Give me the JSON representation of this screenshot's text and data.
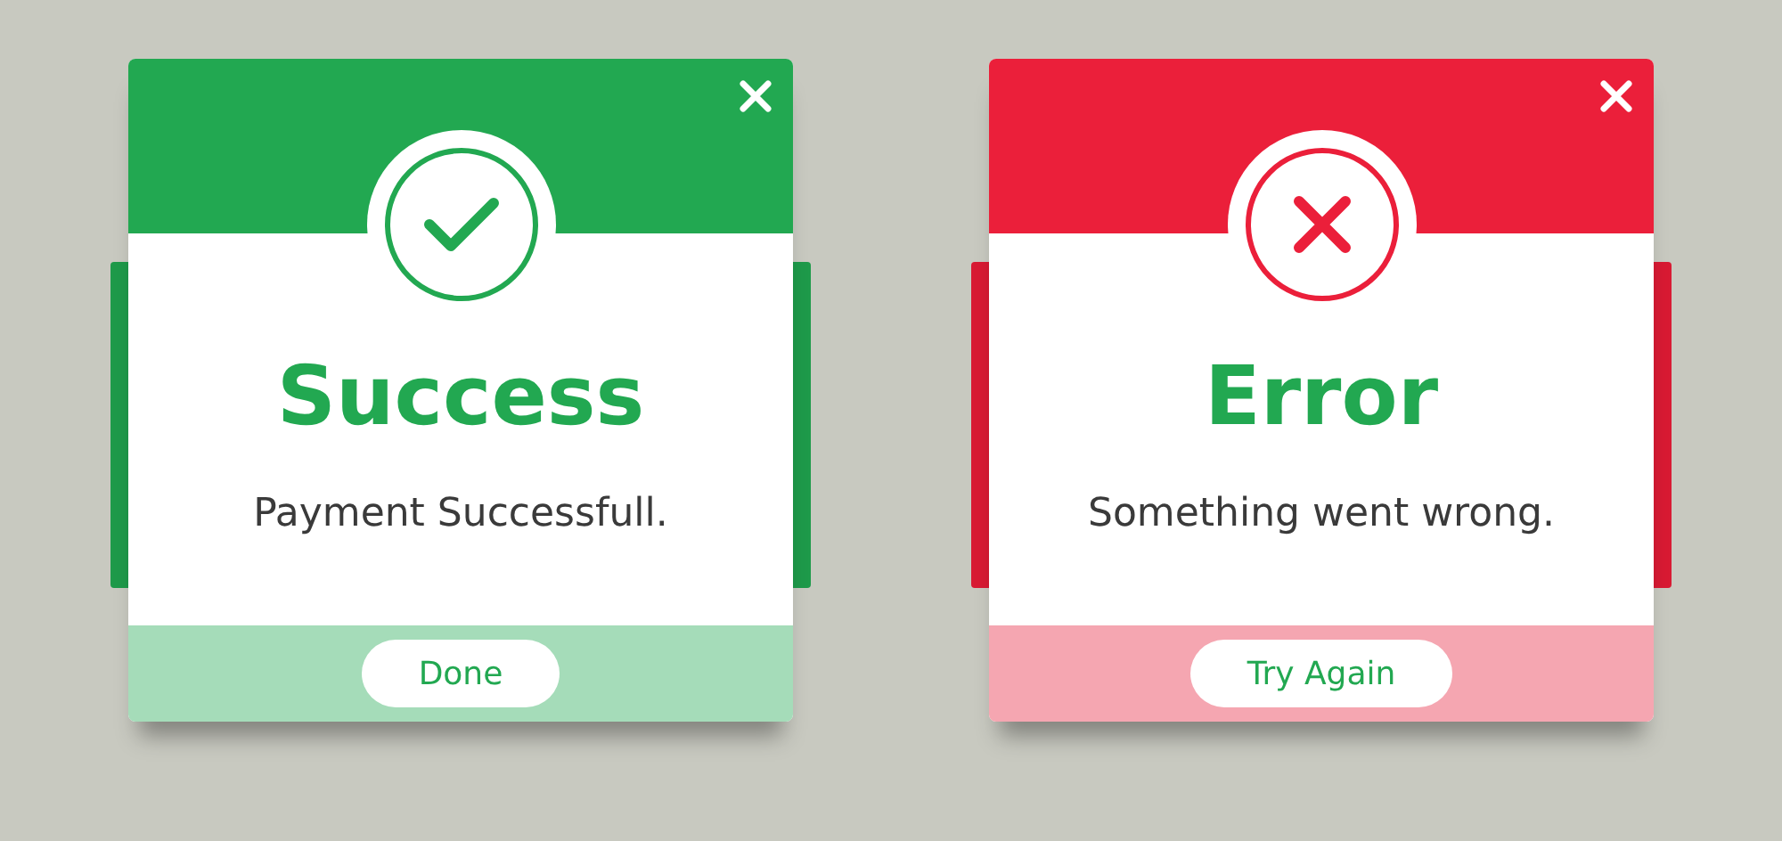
{
  "dialogs": [
    {
      "kind": "success",
      "color": "#22a851",
      "title": "Success",
      "message": "Payment Successfull.",
      "button": "Done"
    },
    {
      "kind": "error",
      "color": "#eb1f3a",
      "title": "Error",
      "message": "Something went wrong.",
      "button": "Try Again"
    }
  ]
}
